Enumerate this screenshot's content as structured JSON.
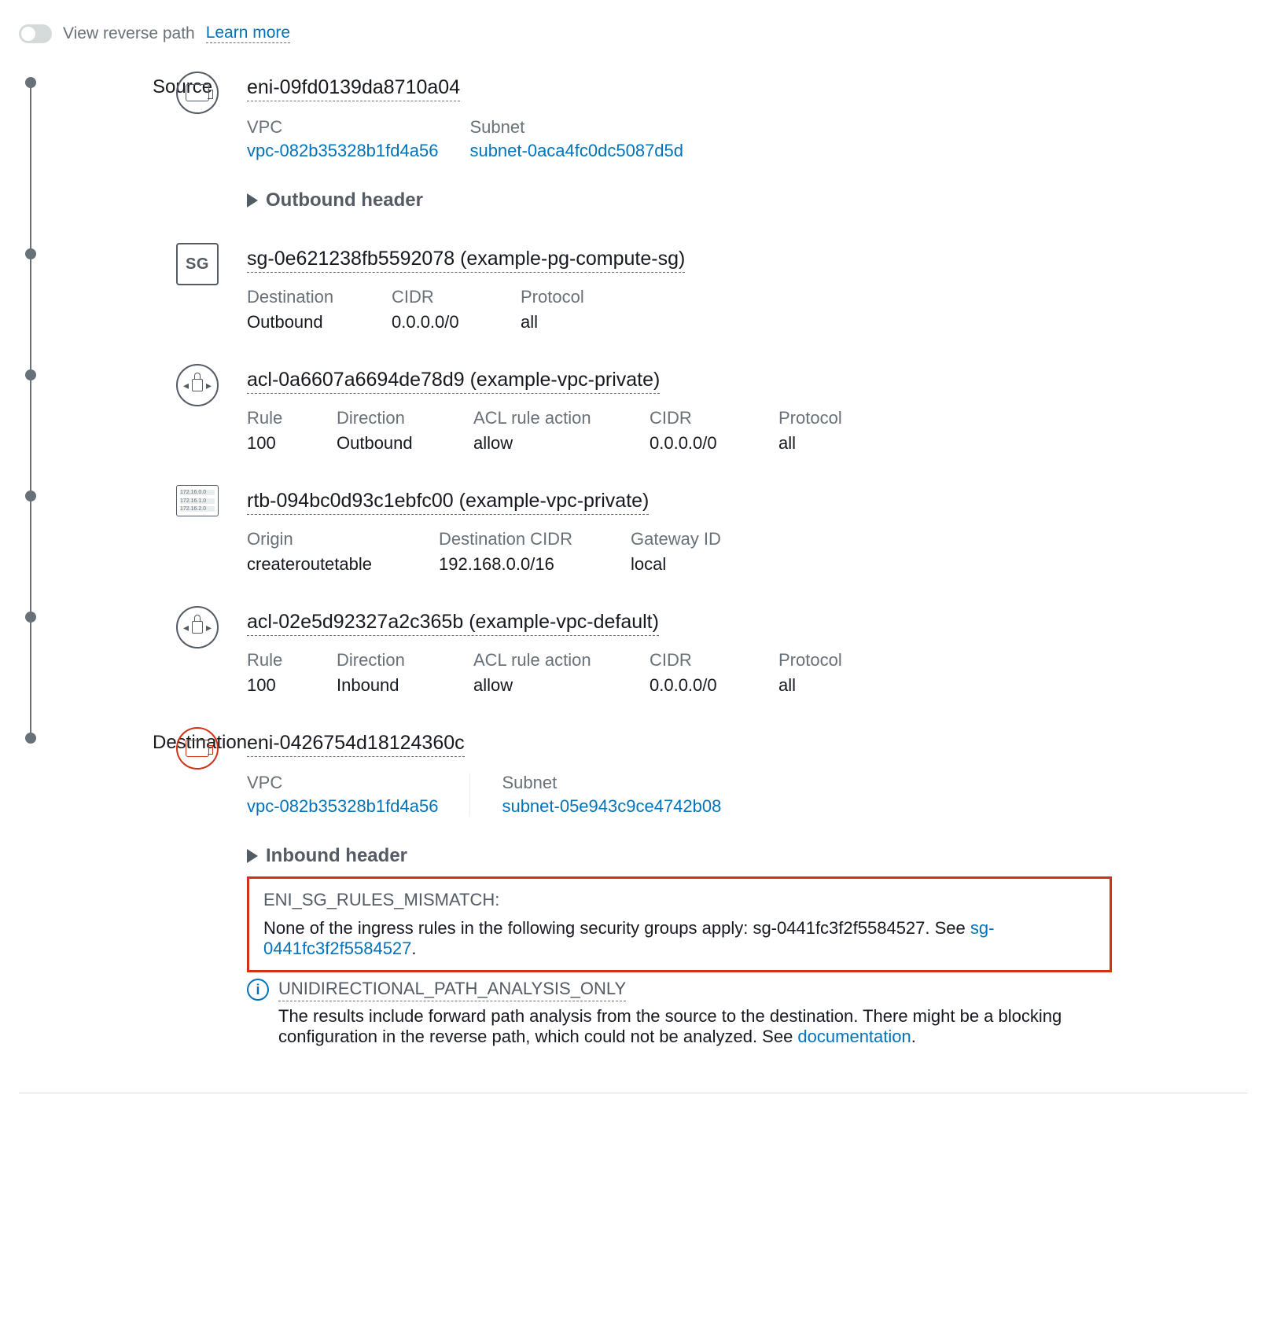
{
  "header": {
    "toggle_label": "View reverse path",
    "learn_more": "Learn more"
  },
  "labels": {
    "source": "Source",
    "destination": "Destination"
  },
  "nodes": [
    {
      "title": "eni-09fd0139da8710a04",
      "meta": [
        {
          "label": "VPC",
          "value": "vpc-082b35328b1fd4a56",
          "link": true
        },
        {
          "label": "Subnet",
          "value": "subnet-0aca4fc0dc5087d5d",
          "link": true
        }
      ],
      "expander": "Outbound header"
    },
    {
      "title": "sg-0e621238fb5592078 (example-pg-compute-sg)",
      "table": {
        "headers": [
          "Destination",
          "CIDR",
          "Protocol"
        ],
        "row": [
          "Outbound",
          "0.0.0.0/0",
          "all"
        ]
      }
    },
    {
      "title": "acl-0a6607a6694de78d9 (example-vpc-private)",
      "table": {
        "headers": [
          "Rule",
          "Direction",
          "ACL rule action",
          "CIDR",
          "Protocol"
        ],
        "row": [
          "100",
          "Outbound",
          "allow",
          "0.0.0.0/0",
          "all"
        ]
      }
    },
    {
      "title": "rtb-094bc0d93c1ebfc00 (example-vpc-private)",
      "table": {
        "headers": [
          "Origin",
          "Destination CIDR",
          "Gateway ID"
        ],
        "row": [
          "createroutetable",
          "192.168.0.0/16",
          "local"
        ]
      }
    },
    {
      "title": "acl-02e5d92327a2c365b (example-vpc-default)",
      "table": {
        "headers": [
          "Rule",
          "Direction",
          "ACL rule action",
          "CIDR",
          "Protocol"
        ],
        "row": [
          "100",
          "Inbound",
          "allow",
          "0.0.0.0/0",
          "all"
        ]
      }
    },
    {
      "title": "eni-0426754d18124360c",
      "meta": [
        {
          "label": "VPC",
          "value": "vpc-082b35328b1fd4a56",
          "link": true
        },
        {
          "label": "Subnet",
          "value": "subnet-05e943c9ce4742b08",
          "link": true
        }
      ],
      "expander": "Inbound header"
    }
  ],
  "error": {
    "code": "ENI_SG_RULES_MISMATCH:",
    "text_pre": "None of the ingress rules in the following security groups apply: sg-0441fc3f2f5584527. See ",
    "link": "sg-0441fc3f2f5584527",
    "text_post": "."
  },
  "info": {
    "code": "UNIDIRECTIONAL_PATH_ANALYSIS_ONLY",
    "text_pre": "The results include forward path analysis from the source to the destination. There might be a blocking configuration in the reverse path, which could not be analyzed. See ",
    "link": "documentation",
    "text_post": "."
  }
}
